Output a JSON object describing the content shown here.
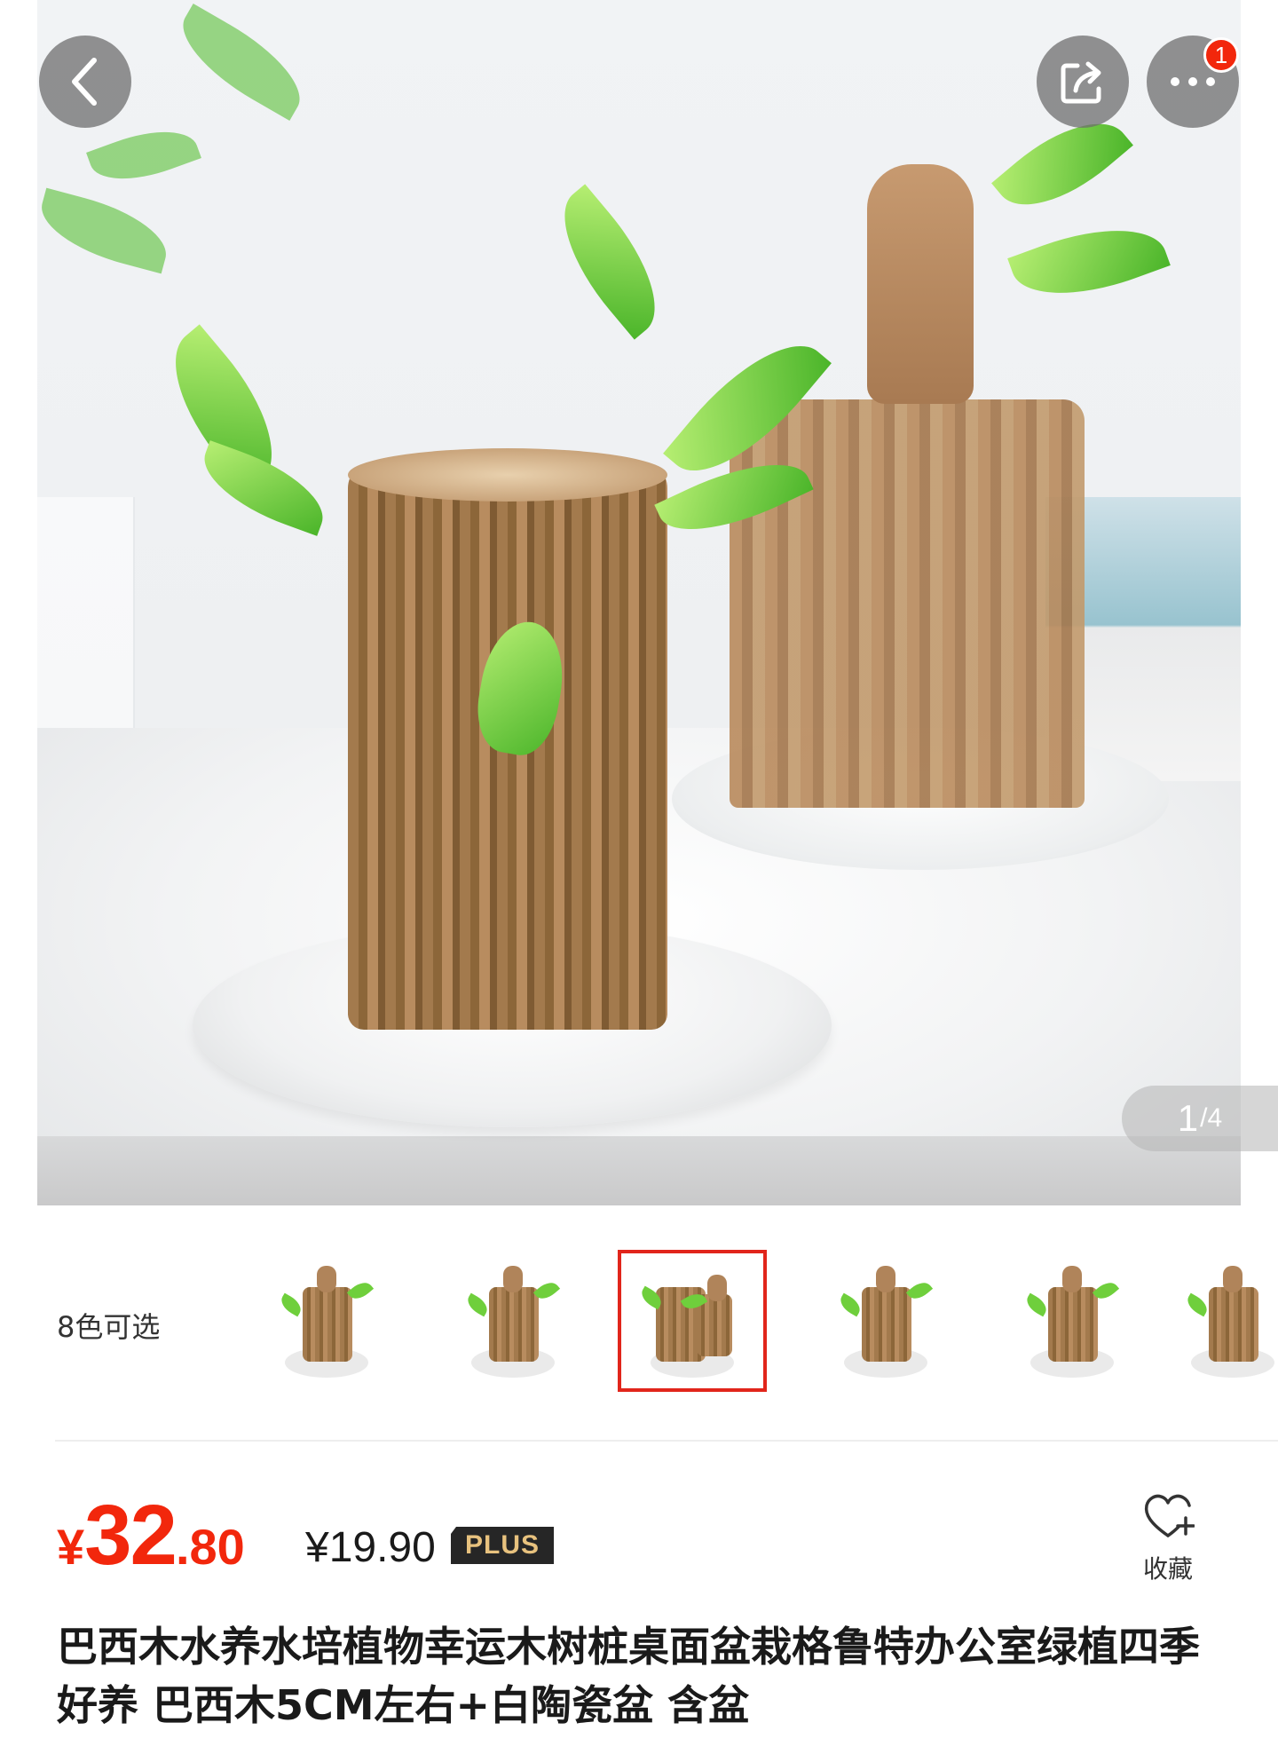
{
  "header": {
    "back_icon": "chevron-left-icon",
    "share_icon": "share-icon",
    "more_icon": "more-dots-icon",
    "more_badge": "1"
  },
  "gallery": {
    "current": "1",
    "separator": "/",
    "total": "4"
  },
  "variants": {
    "label": "8色可选",
    "selected_index": 2,
    "accent_color": "#e1251b"
  },
  "price": {
    "currency": "¥",
    "integer": "32",
    "decimal": ".80",
    "plus_price": "¥19.90",
    "plus_tag": "PLUS",
    "color": "#f2270c"
  },
  "favorite": {
    "icon": "heart-plus-icon",
    "label": "收藏"
  },
  "product": {
    "title": "巴西木水养水培植物幸运木树桩桌面盆栽格鲁特办公室绿植四季好养 巴西木5CM左右+白陶瓷盆 含盆"
  }
}
